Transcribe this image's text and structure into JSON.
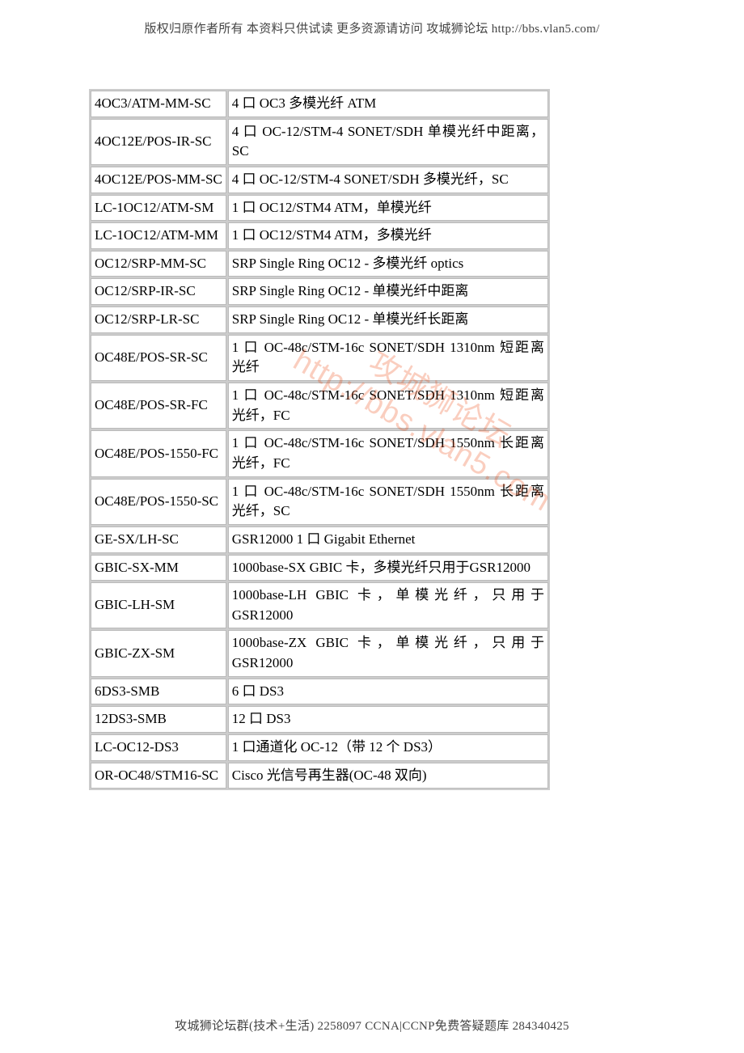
{
  "header_text": "版权归原作者所有 本资料只供试读 更多资源请访问 攻城狮论坛 http://bbs.vlan5.com/",
  "footer_text": "攻城狮论坛群(技术+生活) 2258097 CCNA|CCNP免费答疑题库 284340425",
  "watermark_text": "攻城狮论坛 http://bbs.vlan5.com",
  "table_rows": [
    {
      "code": "4OC3/ATM-MM-SC",
      "desc": "4 口 OC3 多模光纤 ATM"
    },
    {
      "code": "4OC12E/POS-IR-SC",
      "desc": "4 口 OC-12/STM-4 SONET/SDH 单模光纤中距离，SC"
    },
    {
      "code": "4OC12E/POS-MM-SC",
      "desc": "4 口  OC-12/STM-4 SONET/SDH  多模光纤，SC"
    },
    {
      "code": "LC-1OC12/ATM-SM",
      "desc": "1 口  OC12/STM4 ATM，单模光纤"
    },
    {
      "code": "LC-1OC12/ATM-MM",
      "desc": "1 口  OC12/STM4 ATM，多模光纤"
    },
    {
      "code": "OC12/SRP-MM-SC",
      "desc": "SRP Single Ring OC12 -  多模光纤  optics"
    },
    {
      "code": "OC12/SRP-IR-SC",
      "desc": "SRP Single Ring OC12 -  单模光纤中距离"
    },
    {
      "code": "OC12/SRP-LR-SC",
      "desc": "SRP Single Ring OC12 -  单模光纤长距离"
    },
    {
      "code": "OC48E/POS-SR-SC",
      "desc": "1 口  OC-48c/STM-16c SONET/SDH 1310nm 短距离光纤"
    },
    {
      "code": "OC48E/POS-SR-FC",
      "desc": "1 口  OC-48c/STM-16c SONET/SDH 1310nm  短距离光纤，FC"
    },
    {
      "code": "OC48E/POS-1550-FC",
      "desc": "1 口  OC-48c/STM-16c SONET/SDH 1550nm 长距离光纤，FC"
    },
    {
      "code": "OC48E/POS-1550-SC",
      "desc": "1 口  OC-48c/STM-16c SONET/SDH 1550nm 长距离光纤，SC"
    },
    {
      "code": "GE-SX/LH-SC",
      "desc": "GSR12000 1 口  Gigabit Ethernet"
    },
    {
      "code": "GBIC-SX-MM",
      "desc": "1000base-SX GBIC 卡，多模光纤只用于GSR12000"
    },
    {
      "code": "GBIC-LH-SM",
      "desc": "1000base-LH GBIC 卡，单模光纤，只用于GSR12000"
    },
    {
      "code": "GBIC-ZX-SM",
      "desc": "1000base-ZX GBIC 卡，单模光纤，只用于GSR12000"
    },
    {
      "code": "6DS3-SMB",
      "desc": "6 口 DS3"
    },
    {
      "code": "12DS3-SMB",
      "desc": "12 口 DS3"
    },
    {
      "code": "LC-OC12-DS3",
      "desc": "1 口通道化 OC-12（带 12 个 DS3）"
    },
    {
      "code": "OR-OC48/STM16-SC",
      "desc": "Cisco  光信号再生器(OC-48 双向)"
    }
  ]
}
